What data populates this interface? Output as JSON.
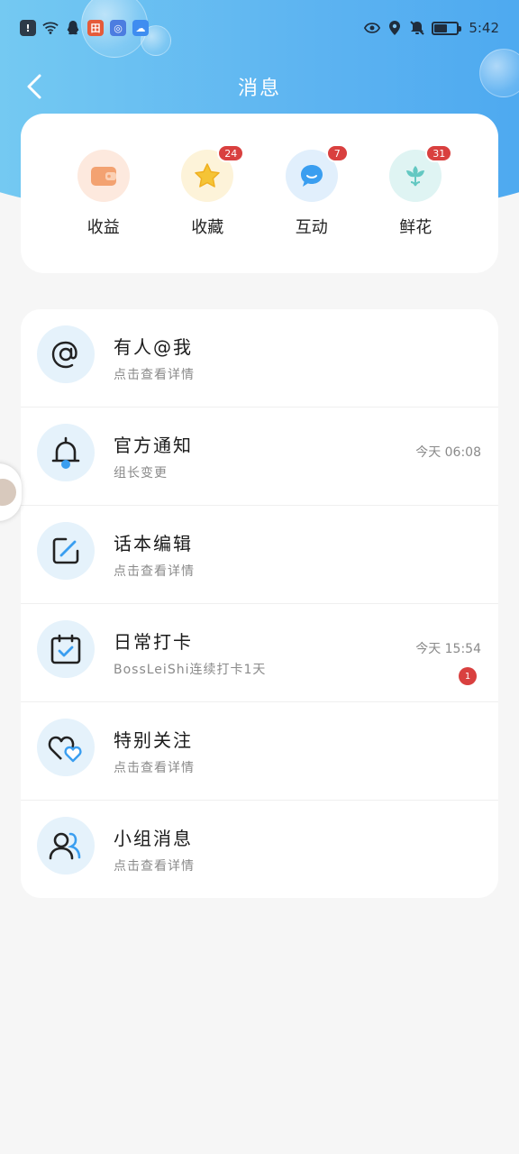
{
  "status_bar": {
    "time": "5:42",
    "left_icons": [
      "alert-icon",
      "wifi-icon",
      "qq-icon",
      "app-icon-orange",
      "app-icon-blue",
      "cloud-icon"
    ],
    "right_icons": [
      "eye-icon",
      "location-icon",
      "mute-icon",
      "battery-icon"
    ]
  },
  "header": {
    "title": "消息"
  },
  "quick": [
    {
      "label": "收益",
      "icon": "wallet-icon",
      "color": "#f3a271",
      "bg": "#fde9de",
      "badge": ""
    },
    {
      "label": "收藏",
      "icon": "star-icon",
      "color": "#f5c436",
      "bg": "#fdf3d9",
      "badge": "24"
    },
    {
      "label": "互动",
      "icon": "chat-bubble-icon",
      "color": "#3a9ef0",
      "bg": "#e1effc",
      "badge": "7"
    },
    {
      "label": "鲜花",
      "icon": "flower-icon",
      "color": "#63c8c2",
      "bg": "#dff4f3",
      "badge": "31"
    }
  ],
  "messages": [
    {
      "title": "有人@我",
      "subtitle": "点击查看详情",
      "time": "",
      "unread": "",
      "icon": "at-icon"
    },
    {
      "title": "官方通知",
      "subtitle": "组长变更",
      "time": "今天 06:08",
      "unread": "",
      "icon": "bell-icon"
    },
    {
      "title": "话本编辑",
      "subtitle": "点击查看详情",
      "time": "",
      "unread": "",
      "icon": "edit-icon"
    },
    {
      "title": "日常打卡",
      "subtitle": "BossLeiShi连续打卡1天",
      "time": "今天 15:54",
      "unread": "1",
      "icon": "calendar-check-icon"
    },
    {
      "title": "特别关注",
      "subtitle": "点击查看详情",
      "time": "",
      "unread": "",
      "icon": "hearts-icon"
    },
    {
      "title": "小组消息",
      "subtitle": "点击查看详情",
      "time": "",
      "unread": "",
      "icon": "group-icon"
    }
  ],
  "colors": {
    "accent": "#4aa7f0",
    "badge": "#d9403f"
  }
}
